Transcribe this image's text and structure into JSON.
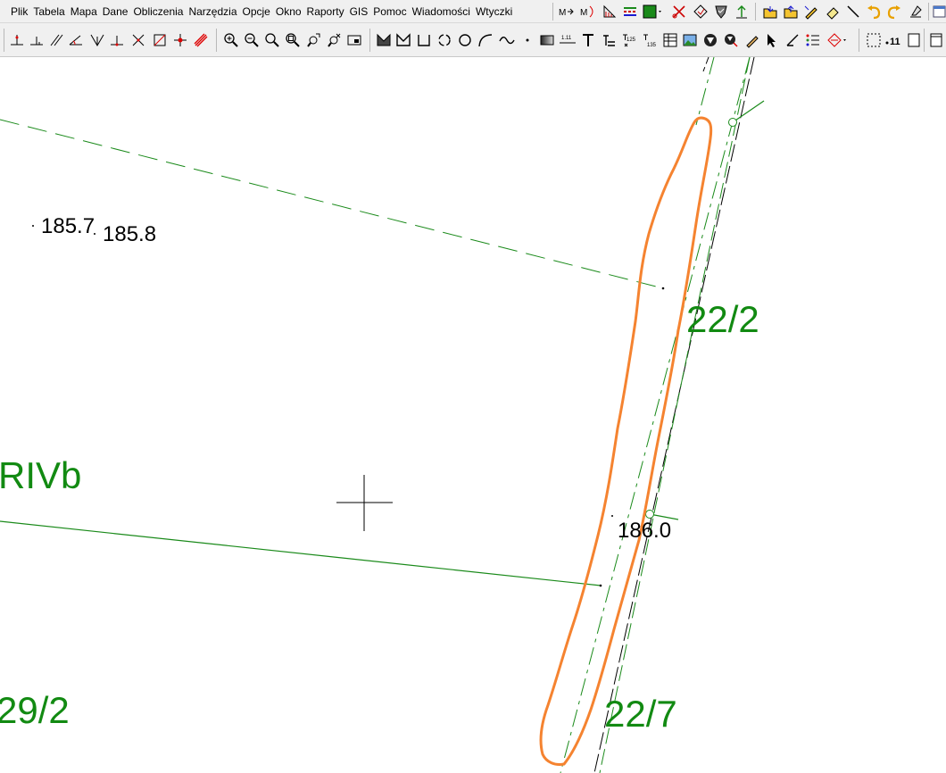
{
  "menu": {
    "items": [
      {
        "label": "Plik"
      },
      {
        "label": "Tabela"
      },
      {
        "label": "Mapa"
      },
      {
        "label": "Dane"
      },
      {
        "label": "Obliczenia"
      },
      {
        "label": "Narzędzia"
      },
      {
        "label": "Opcje"
      },
      {
        "label": "Okno"
      },
      {
        "label": "Raporty"
      },
      {
        "label": "GIS"
      },
      {
        "label": "Pomoc"
      },
      {
        "label": "Wiadomości"
      },
      {
        "label": "Wtyczki"
      }
    ]
  },
  "toolbar": {
    "top_icons": [
      "measure-icon",
      "measure-arc-icon",
      "hatch-icon",
      "legend-icon",
      "fill-color-icon",
      "cut-icon",
      "layer-icon",
      "shield-icon",
      "arrow-up-icon",
      "folder-import-icon",
      "folder-export-icon",
      "edit-icon",
      "eraser-icon",
      "line-icon",
      "undo-icon",
      "redo-icon",
      "clear-icon"
    ],
    "fill_color": "#1a8a1a",
    "bottom_icons": [
      "perp-line-icon",
      "perp-line2-icon",
      "parallel-icon",
      "angle-icon",
      "bisect-icon",
      "perp-base-icon",
      "intersect-icon",
      "rect-snap-icon",
      "cross-snap-icon",
      "hatch-line-icon",
      "zoom-in-icon",
      "zoom-out-icon",
      "zoom-extent-icon",
      "zoom-window-icon",
      "zoom-prev-icon",
      "zoom-next-icon",
      "zoom-page-icon",
      "polygon-icon",
      "polygon-open-icon",
      "rectangle-open-icon",
      "circle-dashed-icon",
      "circle-icon",
      "arc-icon",
      "curve-icon",
      "point-icon",
      "gradient-icon",
      "scale-bar-icon",
      "text-icon",
      "text-multiline-icon",
      "label-125-icon",
      "label-135-icon",
      "table-icon",
      "image-icon",
      "symbol-icon",
      "symbol-select-icon",
      "pencil-icon",
      "pointer-icon",
      "angle-tool-icon",
      "list-icon",
      "grid-snap-icon",
      "select-frame-icon",
      "numbering-icon",
      "frame-icon"
    ],
    "numbering_label": "11",
    "scale_label_1": "1.11",
    "label_125": "125",
    "label_135": "135"
  },
  "map": {
    "elevations": [
      {
        "text": "185.7"
      },
      {
        "text": "185.8"
      },
      {
        "text": "186.0"
      }
    ],
    "parcels": [
      {
        "text": "22/2"
      },
      {
        "text": "RIVb"
      },
      {
        "text": "29/2"
      },
      {
        "text": "22/7"
      }
    ],
    "colors": {
      "parcel_label": "#128a12",
      "green_line": "#1a8a1a",
      "highlight": "#f58330",
      "elevation": "#000000"
    }
  }
}
